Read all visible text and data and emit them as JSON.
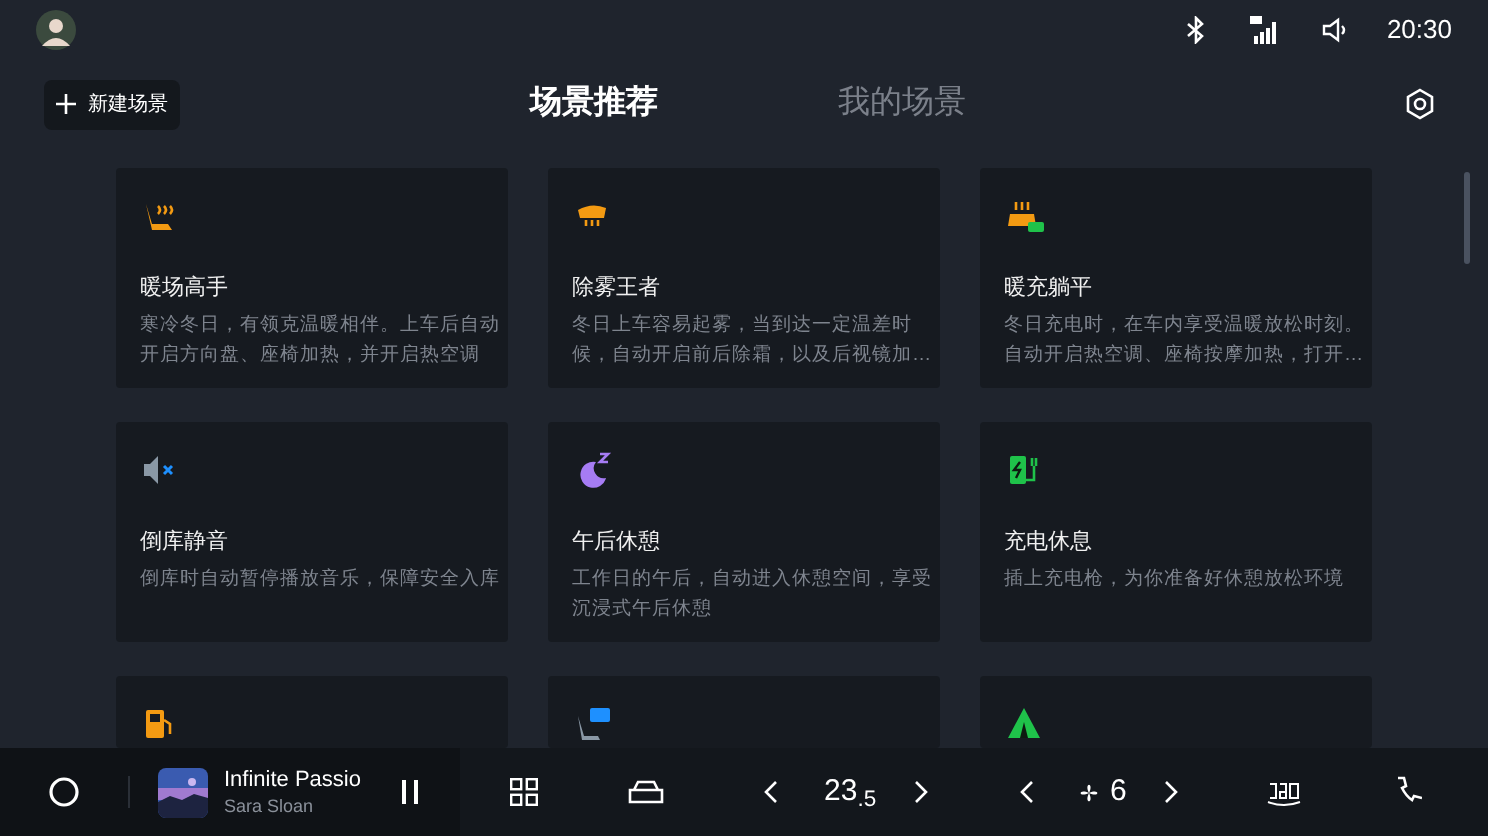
{
  "status_bar": {
    "time": "20:30"
  },
  "header": {
    "new_button": "新建场景",
    "tabs": [
      {
        "label": "场景推荐",
        "selected": true
      },
      {
        "label": "我的场景",
        "selected": false
      }
    ]
  },
  "cards": [
    {
      "kind": "seat-heat",
      "title": "暖场高手",
      "description": "寒冷冬日，有领克温暖相伴。上车后自动开启方向盘、座椅加热，并开启热空调"
    },
    {
      "kind": "defrost",
      "title": "除雾王者",
      "description": "冬日上车容易起雾，当到达一定温差时候，自动开启前后除霜，以及后视镜加…"
    },
    {
      "kind": "warm-charge",
      "title": "暖充躺平",
      "description": "冬日充电时，在车内享受温暖放松时刻。自动开启热空调、座椅按摩加热，打开…"
    },
    {
      "kind": "mute",
      "title": "倒库静音",
      "description": "倒库时自动暂停播放音乐，保障安全入库"
    },
    {
      "kind": "moon",
      "title": "午后休憩",
      "description": "工作日的午后，自动进入休憩空间，享受沉浸式午后休憩"
    },
    {
      "kind": "charger",
      "title": "充电休息",
      "description": "插上充电枪，为你准备好休憩放松环境"
    },
    {
      "kind": "fuel"
    },
    {
      "kind": "seat-screen"
    },
    {
      "kind": "tent"
    }
  ],
  "dock": {
    "media": {
      "title": "Infinite Passio",
      "artist": "Sara Sloan"
    },
    "temperature": "23$_{.5}$",
    "fan_speed": "6"
  }
}
